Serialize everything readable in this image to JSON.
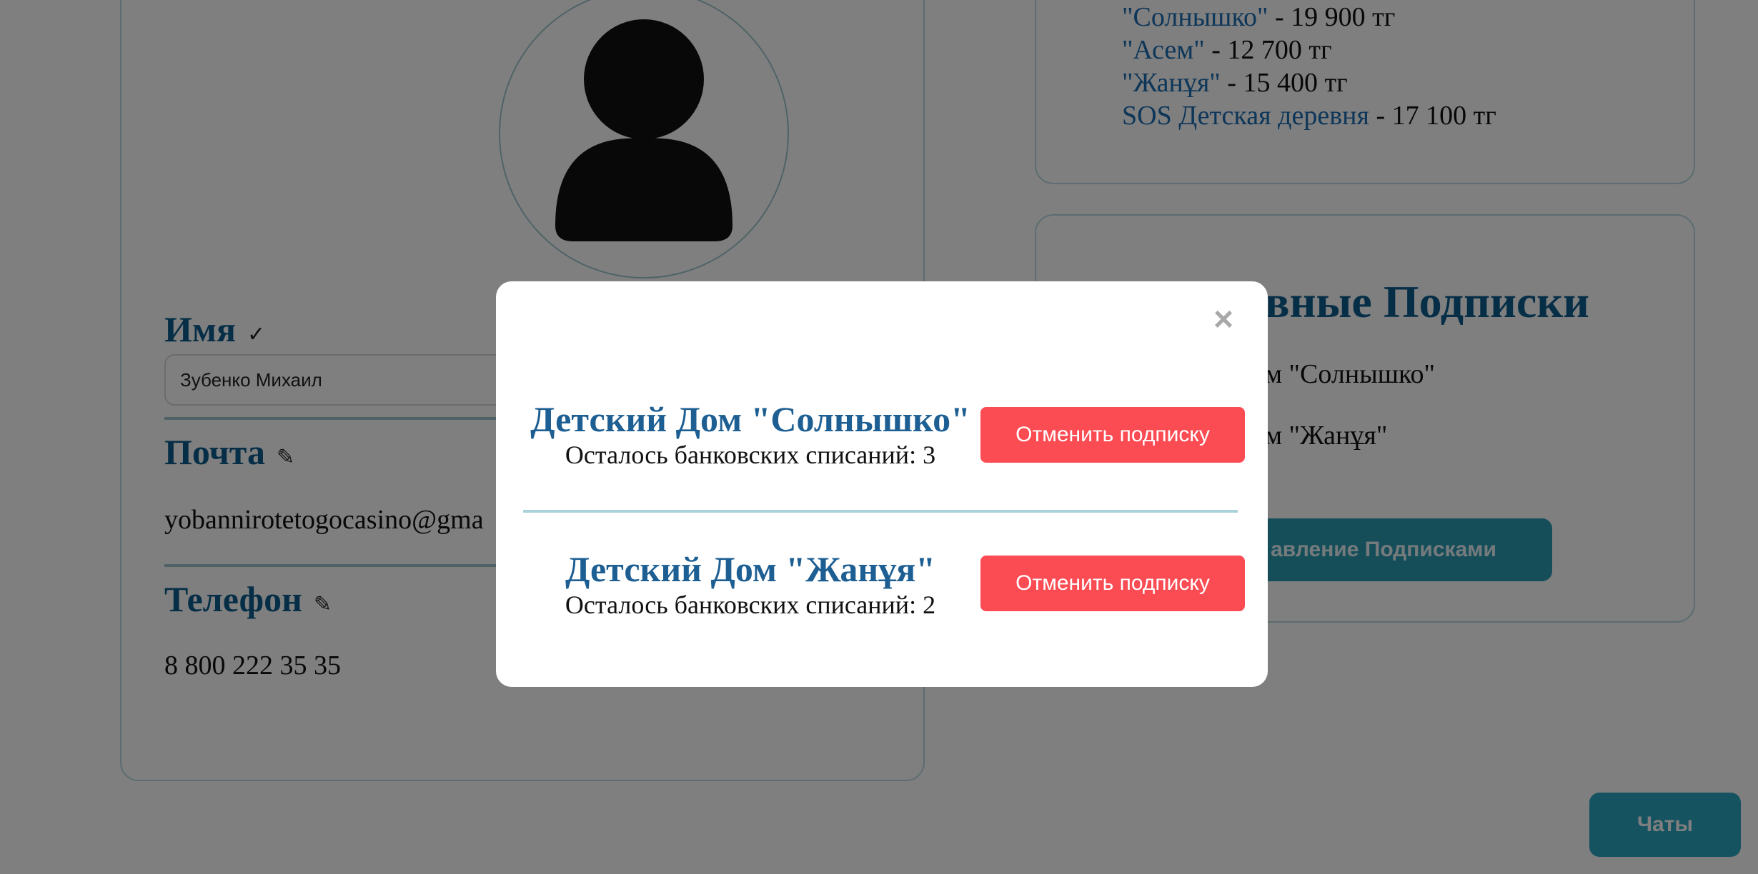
{
  "profile": {
    "name_label": "Имя",
    "name_icon": "✓",
    "name_value": "Зубенко Михаил",
    "email_label": "Почта",
    "email_icon": "✎",
    "email_value": "yobannirotetogocasino@gma",
    "phone_label": "Телефон",
    "phone_icon": "✎",
    "phone_value": "8 800 222 35 35"
  },
  "donations": [
    {
      "org": "\"Солнышко\"",
      "amount": " - 19 900 тг"
    },
    {
      "org": "\"Асем\"",
      "amount": " - 12 700 тг"
    },
    {
      "org": "\"Жанұя\"",
      "amount": " - 15 400 тг"
    },
    {
      "org": "SOS Детская деревня",
      "amount": " - 17 100 тг"
    }
  ],
  "subscriptions_panel": {
    "title": "вные Подписки",
    "items": [
      "м \"Солнышко\"",
      "м \"Жанұя\""
    ],
    "manage_label": "авление Подписками"
  },
  "chats_label": "Чаты",
  "modal": {
    "close_label": "×",
    "subscriptions": [
      {
        "name": "Детский Дом \"Солнышко\"",
        "remaining": "Осталось банковских списаний: 3",
        "cancel_label": "Отменить подписку"
      },
      {
        "name": "Детский Дом \"Жанұя\"",
        "remaining": "Осталось банковских списаний: 2",
        "cancel_label": "Отменить подписку"
      }
    ]
  },
  "colors": {
    "accent": "#0d5e8f",
    "link": "#1b6db3",
    "cancel": "#fb4b53",
    "teal_button": "#2aa6c2",
    "overlay": "rgba(0,0,0,0.5)"
  }
}
